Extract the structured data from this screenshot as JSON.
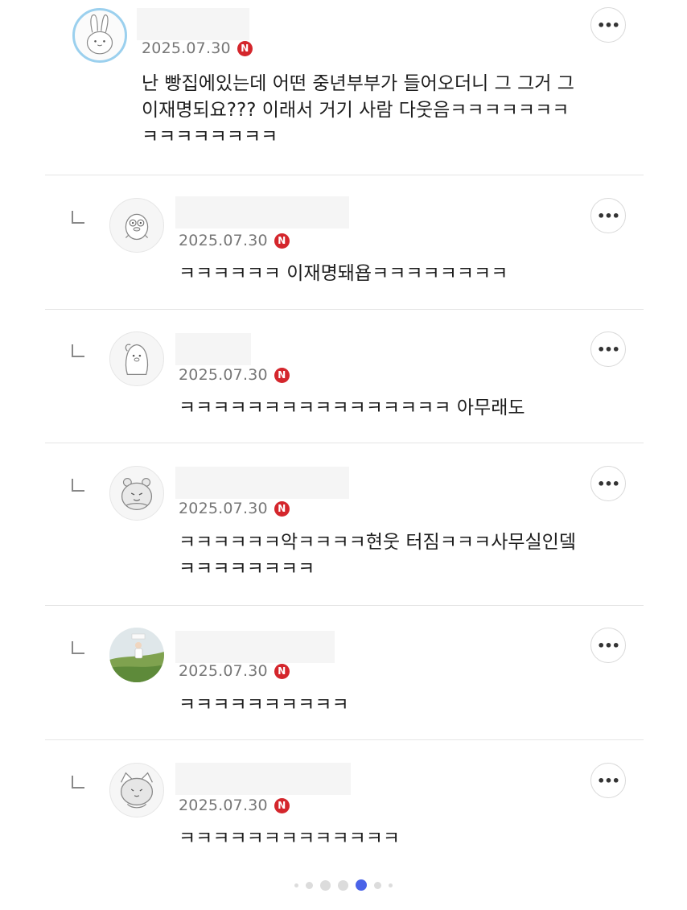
{
  "comments": [
    {
      "date": "2025.07.30",
      "badge": "N",
      "text": "난 빵집에있는데 어떤 중년부부가 들어오더니 그 그거 그\n이재명되요??? 이래서 거기 사람 다웃음ㅋㅋㅋㅋㅋㅋㅋ\nㅋㅋㅋㅋㅋㅋㅋㅋ",
      "more": "•••"
    },
    {
      "date": "2025.07.30",
      "badge": "N",
      "text": "ㅋㅋㅋㅋㅋㅋ 이재명돼욥ㅋㅋㅋㅋㅋㅋㅋㅋ",
      "more": "•••"
    },
    {
      "date": "2025.07.30",
      "badge": "N",
      "text": "ㅋㅋㅋㅋㅋㅋㅋㅋㅋㅋㅋㅋㅋㅋㅋㅋ 아무래도",
      "more": "•••"
    },
    {
      "date": "2025.07.30",
      "badge": "N",
      "text": "ㅋㅋㅋㅋㅋㅋ악ㅋㅋㅋㅋ현웃 터짐ㅋㅋㅋ사무실인뎈\nㅋㅋㅋㅋㅋㅋㅋㅋ",
      "more": "•••"
    },
    {
      "date": "2025.07.30",
      "badge": "N",
      "text": "ㅋㅋㅋㅋㅋㅋㅋㅋㅋㅋ",
      "more": "•••"
    },
    {
      "date": "2025.07.30",
      "badge": "N",
      "text": "ㅋㅋㅋㅋㅋㅋㅋㅋㅋㅋㅋㅋㅋ",
      "more": "•••"
    }
  ],
  "pagination": {
    "total": 7,
    "active_index": 4
  },
  "colors": {
    "badge": "#d4262c",
    "active_dot": "#4a63e8",
    "avatar_ring": "#9bd0ee"
  },
  "icons": [
    "bunny-avatar-icon",
    "chick-avatar-icon",
    "penguin-avatar-icon",
    "hamster-avatar-icon",
    "photo-avatar",
    "cat-avatar-icon",
    "reply-arrow-icon",
    "more-options-icon",
    "new-badge-icon"
  ]
}
